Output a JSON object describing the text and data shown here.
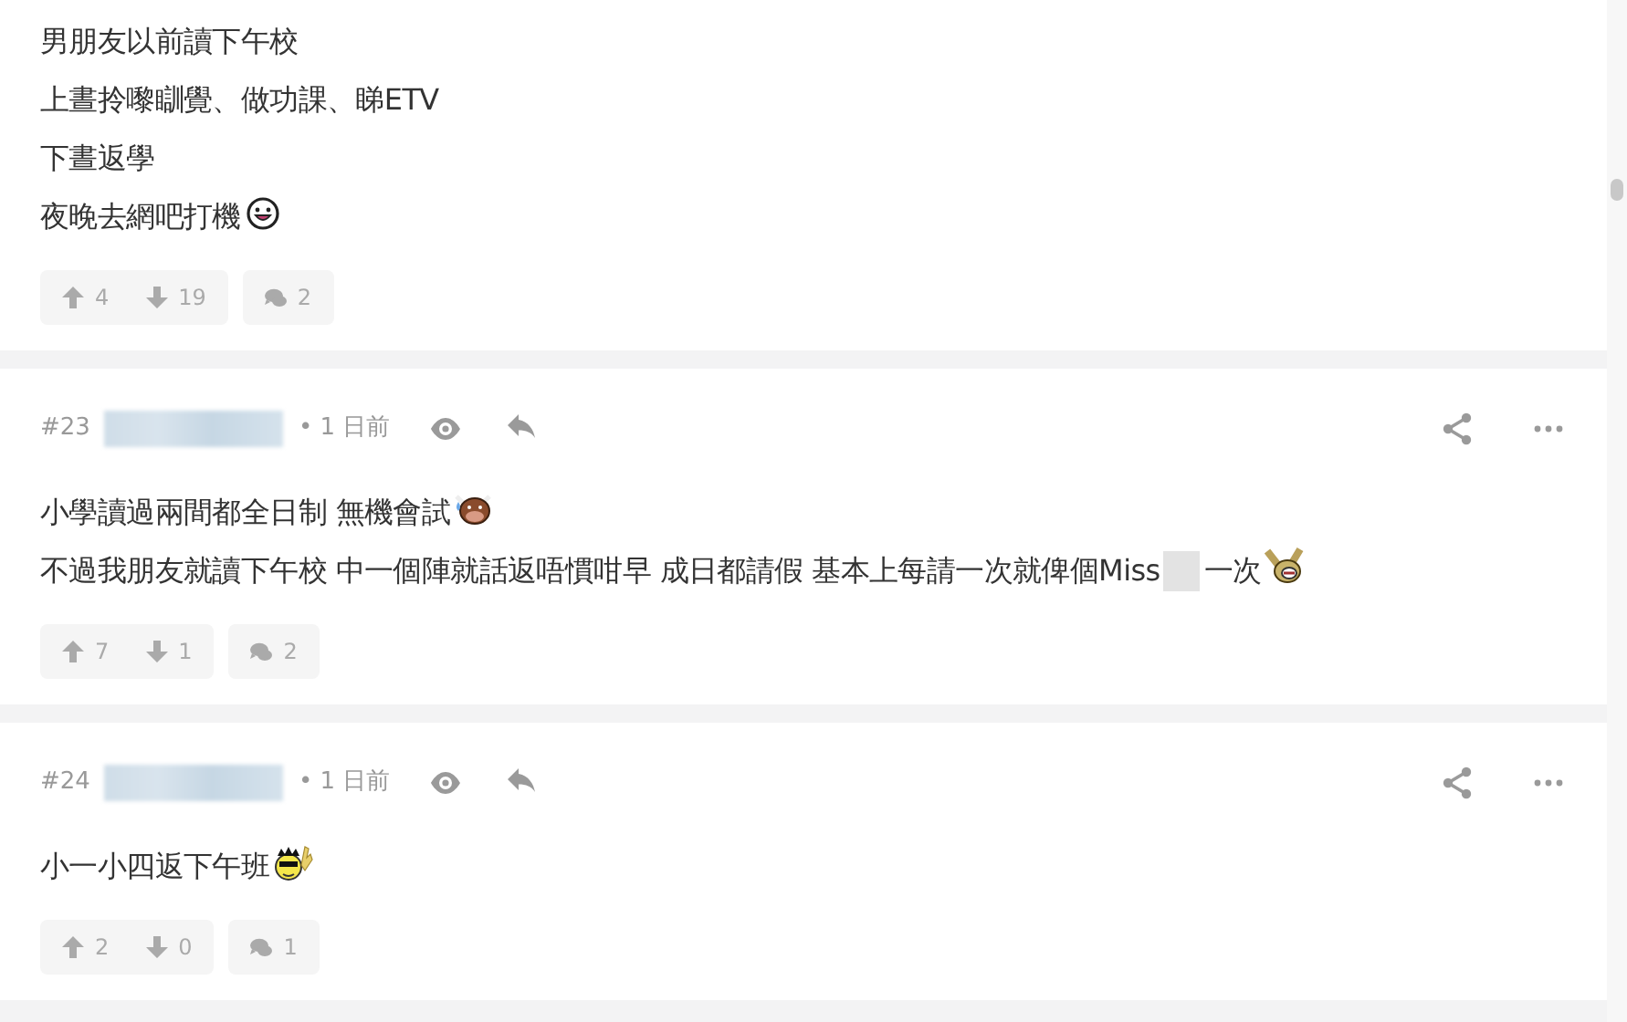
{
  "posts": [
    {
      "lines": [
        [
          {
            "kind": "text",
            "text": "男朋友以前讀下午校"
          }
        ],
        [
          {
            "kind": "text",
            "text": "上晝拎嚟瞓覺、做功課、睇ETV"
          }
        ],
        [
          {
            "kind": "text",
            "text": "下晝返學"
          }
        ],
        [
          {
            "kind": "text",
            "text": "夜晚去網吧打機"
          },
          {
            "kind": "emoji"
          }
        ]
      ],
      "up": "4",
      "down": "19",
      "replies": "2"
    },
    {
      "header": {
        "number": "#23",
        "username_hidden": true,
        "time": "• 1 日前"
      },
      "lines": [
        [
          {
            "kind": "text",
            "text": "小學讀過兩間都全日制 無機會試"
          },
          {
            "kind": "emoji"
          }
        ],
        [
          {
            "kind": "text",
            "text": "不過我朋友就讀下午校 中一個陣就話返唔慣咁早 成日都請假 基本上每請一次就俾個Miss"
          },
          {
            "kind": "redacted"
          },
          {
            "kind": "text",
            "text": "一次"
          },
          {
            "kind": "emoji"
          }
        ]
      ],
      "up": "7",
      "down": "1",
      "replies": "2"
    },
    {
      "header": {
        "number": "#24",
        "username_hidden": true,
        "time": "• 1 日前"
      },
      "lines": [
        [
          {
            "kind": "text",
            "text": "小一小四返下午班"
          },
          {
            "kind": "emoji"
          }
        ]
      ],
      "up": "2",
      "down": "0",
      "replies": "1"
    }
  ]
}
